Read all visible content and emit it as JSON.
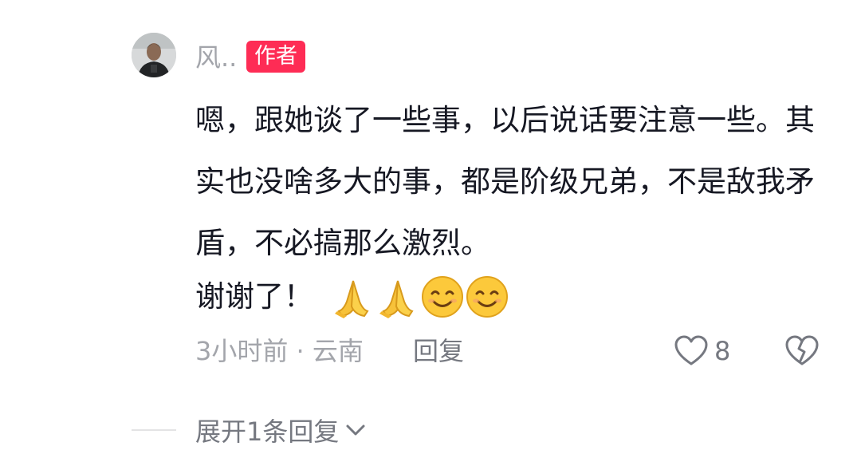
{
  "comment": {
    "author_name": "风..",
    "author_badge": "作者",
    "text": "嗯，跟她谈了一些事，以后说话要注意一些。其实也没啥多大的事，都是阶级兄弟，不是敌我矛盾，不必搞那么激烈。",
    "thanks_text": "谢谢了！",
    "emojis": [
      "folded-hands",
      "folded-hands",
      "smiling-face",
      "smiling-face"
    ],
    "meta": "3小时前 · 云南",
    "reply_label": "回复",
    "like_count": "8"
  },
  "replies": {
    "expand_label": "展开1条回复"
  },
  "colors": {
    "badge": "#fe2c55",
    "muted_text": "#a3a5ab",
    "secondary_text": "#757880",
    "primary_text": "#161823"
  }
}
